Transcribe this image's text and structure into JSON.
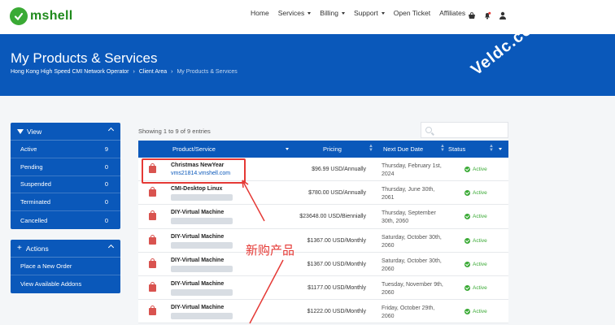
{
  "brand": {
    "logo_text": "mshell",
    "accent": "#0a58ba",
    "logo_color": "#3aaa35"
  },
  "nav": {
    "items": [
      {
        "label": "Home",
        "dropdown": false
      },
      {
        "label": "Services",
        "dropdown": true
      },
      {
        "label": "Billing",
        "dropdown": true
      },
      {
        "label": "Support",
        "dropdown": true
      },
      {
        "label": "Open Ticket",
        "dropdown": false
      },
      {
        "label": "Affiliates",
        "dropdown": false
      }
    ],
    "icons": [
      "basket-icon",
      "bell-icon",
      "user-icon"
    ]
  },
  "hero": {
    "title": "My Products & Services",
    "breadcrumb": [
      "Hong Kong High Speed CMI Network Operator",
      "Client Area",
      "My Products & Services"
    ],
    "watermark": "Veldc.com"
  },
  "view_panel": {
    "title": "View",
    "items": [
      {
        "label": "Active",
        "count": "9"
      },
      {
        "label": "Pending",
        "count": "0"
      },
      {
        "label": "Suspended",
        "count": "0"
      },
      {
        "label": "Terminated",
        "count": "0"
      },
      {
        "label": "Cancelled",
        "count": "0"
      }
    ]
  },
  "actions_panel": {
    "title": "Actions",
    "items": [
      "Place a New Order",
      "View Available Addons"
    ]
  },
  "table": {
    "entries_text": "Showing 1 to 9 of 9 entries",
    "headers": {
      "product": "Product/Service",
      "pricing": "Pricing",
      "due": "Next Due Date",
      "status": "Status"
    },
    "rows": [
      {
        "name": "Christmas NewYear",
        "domain": "vms21814.vmshell.com",
        "price": "$96.99 USD/Annually",
        "due": "Thursday, February 1st, 2024",
        "status": "Active"
      },
      {
        "name": "CMI-Desktop Linux",
        "domain": "",
        "price": "$780.00 USD/Annually",
        "due": "Thursday, June 30th, 2061",
        "status": "Active"
      },
      {
        "name": "DIY-Virtual Machine",
        "domain": "",
        "price": "$23648.00 USD/Biennially",
        "due": "Thursday, September 30th, 2060",
        "status": "Active"
      },
      {
        "name": "DIY-Virtual Machine",
        "domain": "",
        "price": "$1367.00 USD/Monthly",
        "due": "Saturday, October 30th, 2060",
        "status": "Active"
      },
      {
        "name": "DIY-Virtual Machine",
        "domain": "",
        "price": "$1367.00 USD/Monthly",
        "due": "Saturday, October 30th, 2060",
        "status": "Active"
      },
      {
        "name": "DIY-Virtual Machine",
        "domain": "",
        "price": "$1177.00 USD/Monthly",
        "due": "Tuesday, November 9th, 2060",
        "status": "Active"
      },
      {
        "name": "DIY-Virtual Machine",
        "domain": "",
        "price": "$1222.00 USD/Monthly",
        "due": "Friday, October 29th, 2060",
        "status": "Active"
      }
    ]
  },
  "annotation": {
    "text": "新购产品",
    "color": "#e53935"
  }
}
